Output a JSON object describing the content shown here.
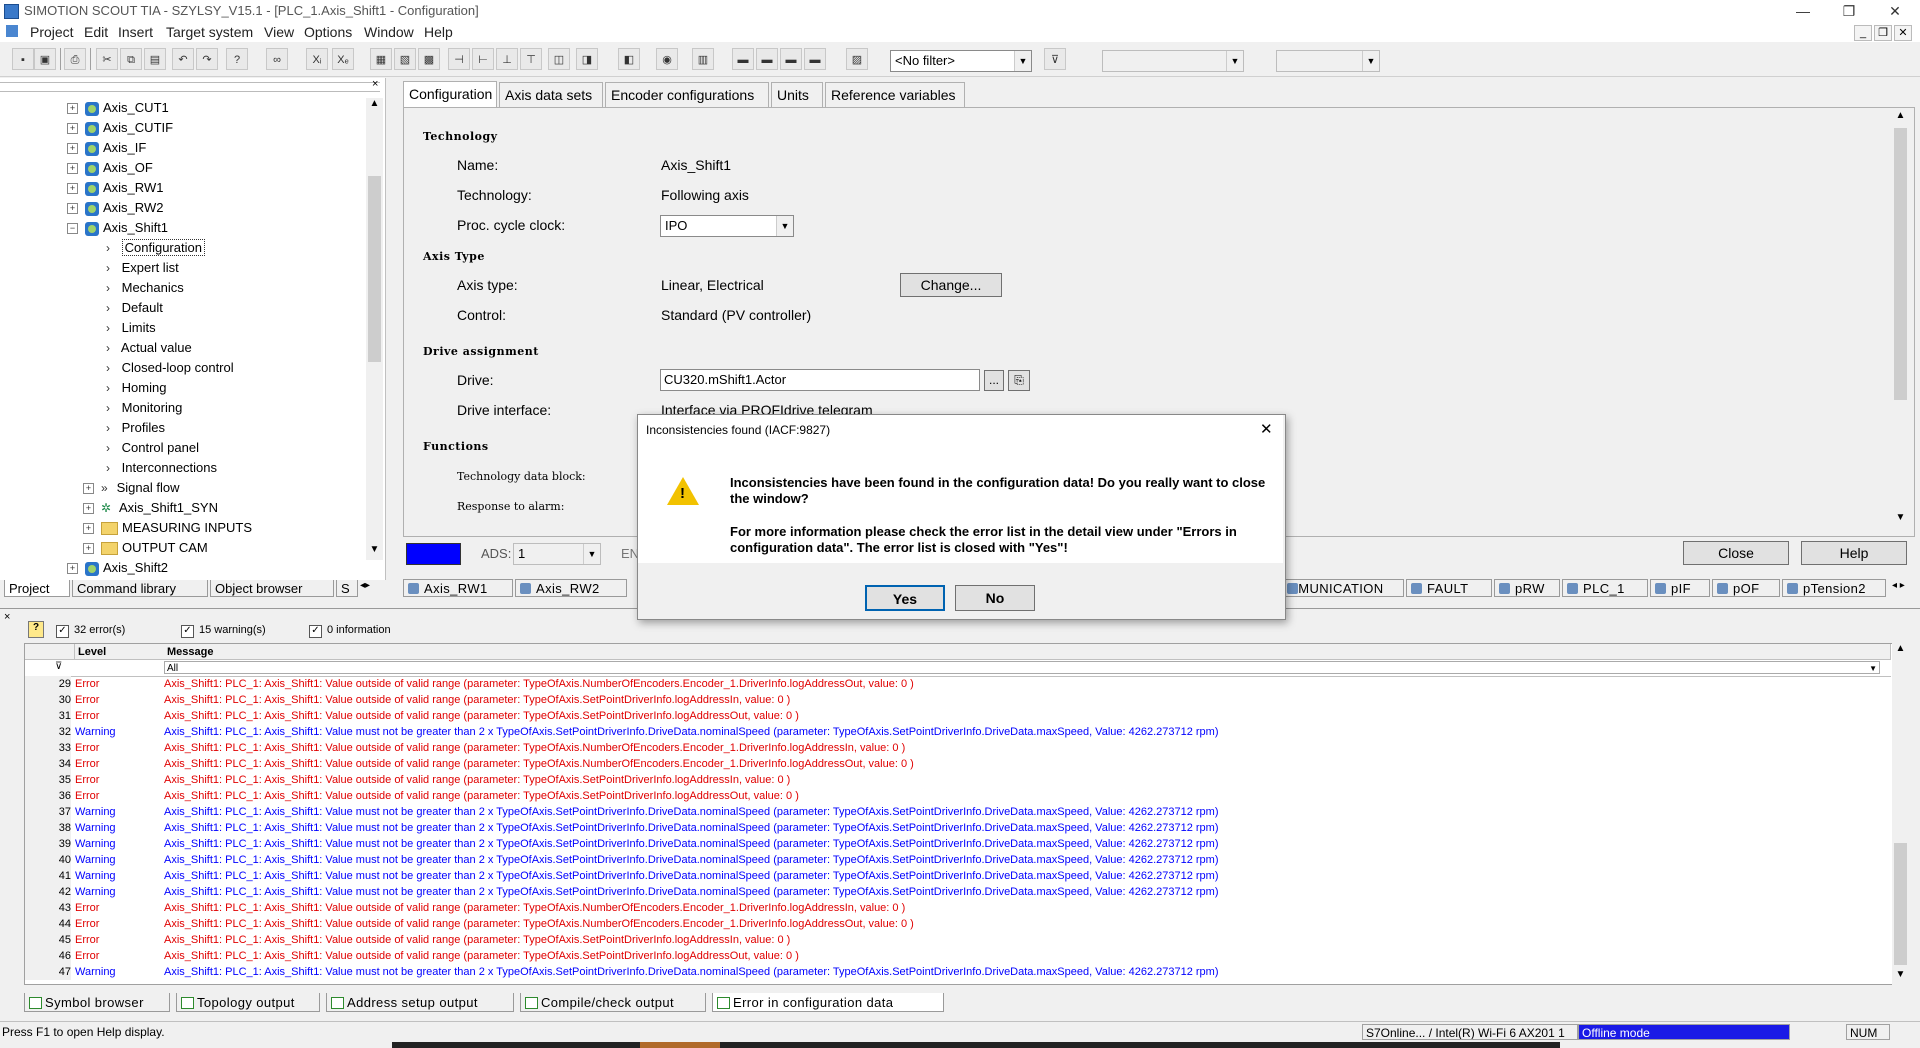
{
  "window": {
    "title": "SIMOTION SCOUT TIA - SZYLSY_V15.1 - [PLC_1.Axis_Shift1 - Configuration]",
    "minimize": "—",
    "maximize": "❐",
    "close": "✕"
  },
  "menu": {
    "items": [
      "Project",
      "Edit",
      "Insert",
      "Target system",
      "View",
      "Options",
      "Window",
      "Help"
    ]
  },
  "toolbar": {
    "filter_value": "<No filter>",
    "combo2_value": "",
    "combo3_value": ""
  },
  "tree": {
    "items": [
      {
        "label": "Axis_CUT1",
        "kind": "axis"
      },
      {
        "label": "Axis_CUTIF",
        "kind": "axis"
      },
      {
        "label": "Axis_IF",
        "kind": "axis"
      },
      {
        "label": "Axis_OF",
        "kind": "axis"
      },
      {
        "label": "Axis_RW1",
        "kind": "axis"
      },
      {
        "label": "Axis_RW2",
        "kind": "axis"
      },
      {
        "label": "Axis_Shift1",
        "kind": "axis-open"
      },
      {
        "label": "Configuration",
        "kind": "child-selected"
      },
      {
        "label": "Expert list",
        "kind": "child"
      },
      {
        "label": "Mechanics",
        "kind": "child"
      },
      {
        "label": "Default",
        "kind": "child"
      },
      {
        "label": "Limits",
        "kind": "child"
      },
      {
        "label": "Actual value",
        "kind": "child"
      },
      {
        "label": "Closed-loop control",
        "kind": "child"
      },
      {
        "label": "Homing",
        "kind": "child"
      },
      {
        "label": "Monitoring",
        "kind": "child"
      },
      {
        "label": "Profiles",
        "kind": "child"
      },
      {
        "label": "Control panel",
        "kind": "child"
      },
      {
        "label": "Interconnections",
        "kind": "child"
      },
      {
        "label": "Signal flow",
        "kind": "child-plus"
      },
      {
        "label": "Axis_Shift1_SYN",
        "kind": "syn"
      },
      {
        "label": "MEASURING INPUTS",
        "kind": "folder"
      },
      {
        "label": "OUTPUT CAM",
        "kind": "folder"
      },
      {
        "label": "Axis_Shift2",
        "kind": "axis"
      }
    ],
    "tabs": [
      "Project",
      "Command library",
      "Object browser",
      "S"
    ]
  },
  "config": {
    "tabs": [
      "Configuration",
      "Axis data sets",
      "Encoder configurations",
      "Units",
      "Reference variables"
    ],
    "sections": {
      "technology": "Technology",
      "axis_type": "Axis Type",
      "drive_assignment": "Drive assignment",
      "functions": "Functions"
    },
    "name_label": "Name:",
    "name_value": "Axis_Shift1",
    "technology_label": "Technology:",
    "technology_value": "Following axis",
    "cycle_label": "Proc. cycle clock:",
    "cycle_value": "IPO",
    "axis_type_label": "Axis type:",
    "axis_type_value": "Linear, Electrical",
    "change_button": "Change...",
    "control_label": "Control:",
    "control_value": "Standard (PV controller)",
    "drive_label": "Drive:",
    "drive_value": "CU320.mShift1.Actor",
    "drive_browse": "...",
    "drive_interface_label": "Drive interface:",
    "drive_interface_value": "Interface via PROFIdrive telegram",
    "tech_db_label": "Technology data block:",
    "alarm_label": "Response to alarm:",
    "ads_label": "ADS:",
    "ads_value": "1",
    "en_label": "EN",
    "close_button": "Close",
    "help_button": "Help"
  },
  "editor_tabs": {
    "left": [
      "Axis_RW1",
      "Axis_RW2"
    ],
    "right": [
      "MMUNICATION",
      "FAULT",
      "pRW",
      "PLC_1",
      "pIF",
      "pOF",
      "pTension2"
    ]
  },
  "dialog": {
    "title": "Inconsistencies found (IACF:9827)",
    "message1": "Inconsistencies have been found in the configuration data! Do you really want to close the window?",
    "message2": "For more information please check the error list in the detail view under \"Errors in configuration data\". The error list is closed with \"Yes\"!",
    "yes": "Yes",
    "no": "No",
    "close": "✕"
  },
  "detail": {
    "errors_label": "32 error(s)",
    "warnings_label": "15 warning(s)",
    "info_label": "0 information",
    "col_level": "Level",
    "col_message": "Message",
    "filter_all": "All",
    "rows": [
      {
        "n": "29",
        "level": "Error",
        "msg": "Axis_Shift1: PLC_1: Axis_Shift1: Value outside of valid range (parameter: TypeOfAxis.NumberOfEncoders.Encoder_1.DriverInfo.logAddressOut, value: 0 )"
      },
      {
        "n": "30",
        "level": "Error",
        "msg": "Axis_Shift1: PLC_1: Axis_Shift1: Value outside of valid range (parameter: TypeOfAxis.SetPointDriverInfo.logAddressIn, value: 0 )"
      },
      {
        "n": "31",
        "level": "Error",
        "msg": "Axis_Shift1: PLC_1: Axis_Shift1: Value outside of valid range (parameter: TypeOfAxis.SetPointDriverInfo.logAddressOut, value: 0 )"
      },
      {
        "n": "32",
        "level": "Warning",
        "msg": "Axis_Shift1: PLC_1: Axis_Shift1: Value must not be greater than 2 x TypeOfAxis.SetPointDriverInfo.DriveData.nominalSpeed (parameter: TypeOfAxis.SetPointDriverInfo.DriveData.maxSpeed, Value: 4262.273712 rpm)"
      },
      {
        "n": "33",
        "level": "Error",
        "msg": "Axis_Shift1: PLC_1: Axis_Shift1: Value outside of valid range (parameter: TypeOfAxis.NumberOfEncoders.Encoder_1.DriverInfo.logAddressIn, value: 0 )"
      },
      {
        "n": "34",
        "level": "Error",
        "msg": "Axis_Shift1: PLC_1: Axis_Shift1: Value outside of valid range (parameter: TypeOfAxis.NumberOfEncoders.Encoder_1.DriverInfo.logAddressOut, value: 0 )"
      },
      {
        "n": "35",
        "level": "Error",
        "msg": "Axis_Shift1: PLC_1: Axis_Shift1: Value outside of valid range (parameter: TypeOfAxis.SetPointDriverInfo.logAddressIn, value: 0 )"
      },
      {
        "n": "36",
        "level": "Error",
        "msg": "Axis_Shift1: PLC_1: Axis_Shift1: Value outside of valid range (parameter: TypeOfAxis.SetPointDriverInfo.logAddressOut, value: 0 )"
      },
      {
        "n": "37",
        "level": "Warning",
        "msg": "Axis_Shift1: PLC_1: Axis_Shift1: Value must not be greater than 2 x TypeOfAxis.SetPointDriverInfo.DriveData.nominalSpeed (parameter: TypeOfAxis.SetPointDriverInfo.DriveData.maxSpeed, Value: 4262.273712 rpm)"
      },
      {
        "n": "38",
        "level": "Warning",
        "msg": "Axis_Shift1: PLC_1: Axis_Shift1: Value must not be greater than 2 x TypeOfAxis.SetPointDriverInfo.DriveData.nominalSpeed (parameter: TypeOfAxis.SetPointDriverInfo.DriveData.maxSpeed, Value: 4262.273712 rpm)"
      },
      {
        "n": "39",
        "level": "Warning",
        "msg": "Axis_Shift1: PLC_1: Axis_Shift1: Value must not be greater than 2 x TypeOfAxis.SetPointDriverInfo.DriveData.nominalSpeed (parameter: TypeOfAxis.SetPointDriverInfo.DriveData.maxSpeed, Value: 4262.273712 rpm)"
      },
      {
        "n": "40",
        "level": "Warning",
        "msg": "Axis_Shift1: PLC_1: Axis_Shift1: Value must not be greater than 2 x TypeOfAxis.SetPointDriverInfo.DriveData.nominalSpeed (parameter: TypeOfAxis.SetPointDriverInfo.DriveData.maxSpeed, Value: 4262.273712 rpm)"
      },
      {
        "n": "41",
        "level": "Warning",
        "msg": "Axis_Shift1: PLC_1: Axis_Shift1: Value must not be greater than 2 x TypeOfAxis.SetPointDriverInfo.DriveData.nominalSpeed (parameter: TypeOfAxis.SetPointDriverInfo.DriveData.maxSpeed, Value: 4262.273712 rpm)"
      },
      {
        "n": "42",
        "level": "Warning",
        "msg": "Axis_Shift1: PLC_1: Axis_Shift1: Value must not be greater than 2 x TypeOfAxis.SetPointDriverInfo.DriveData.nominalSpeed (parameter: TypeOfAxis.SetPointDriverInfo.DriveData.maxSpeed, Value: 4262.273712 rpm)"
      },
      {
        "n": "43",
        "level": "Error",
        "msg": "Axis_Shift1: PLC_1: Axis_Shift1: Value outside of valid range (parameter: TypeOfAxis.NumberOfEncoders.Encoder_1.DriverInfo.logAddressIn, value: 0 )"
      },
      {
        "n": "44",
        "level": "Error",
        "msg": "Axis_Shift1: PLC_1: Axis_Shift1: Value outside of valid range (parameter: TypeOfAxis.NumberOfEncoders.Encoder_1.DriverInfo.logAddressOut, value: 0 )"
      },
      {
        "n": "45",
        "level": "Error",
        "msg": "Axis_Shift1: PLC_1: Axis_Shift1: Value outside of valid range (parameter: TypeOfAxis.SetPointDriverInfo.logAddressIn, value: 0 )"
      },
      {
        "n": "46",
        "level": "Error",
        "msg": "Axis_Shift1: PLC_1: Axis_Shift1: Value outside of valid range (parameter: TypeOfAxis.SetPointDriverInfo.logAddressOut, value: 0 )"
      },
      {
        "n": "47",
        "level": "Warning",
        "msg": "Axis_Shift1: PLC_1: Axis_Shift1: Value must not be greater than 2 x TypeOfAxis.SetPointDriverInfo.DriveData.nominalSpeed (parameter: TypeOfAxis.SetPointDriverInfo.DriveData.maxSpeed, Value: 4262.273712 rpm)"
      }
    ],
    "tabs": [
      "Symbol browser",
      "Topology output",
      "Address setup output",
      "Compile/check output",
      "Error in configuration data"
    ]
  },
  "status": {
    "help": "Press F1 to open Help display.",
    "connection": "S7Online... / Intel(R) Wi-Fi 6 AX201 1",
    "mode": "Offline mode",
    "num": "NUM"
  },
  "colors": {
    "error": "#e00000",
    "warning": "#0000ff",
    "offline_mode_bg": "#1a1ae6",
    "warning_icon": "#f2c200"
  }
}
